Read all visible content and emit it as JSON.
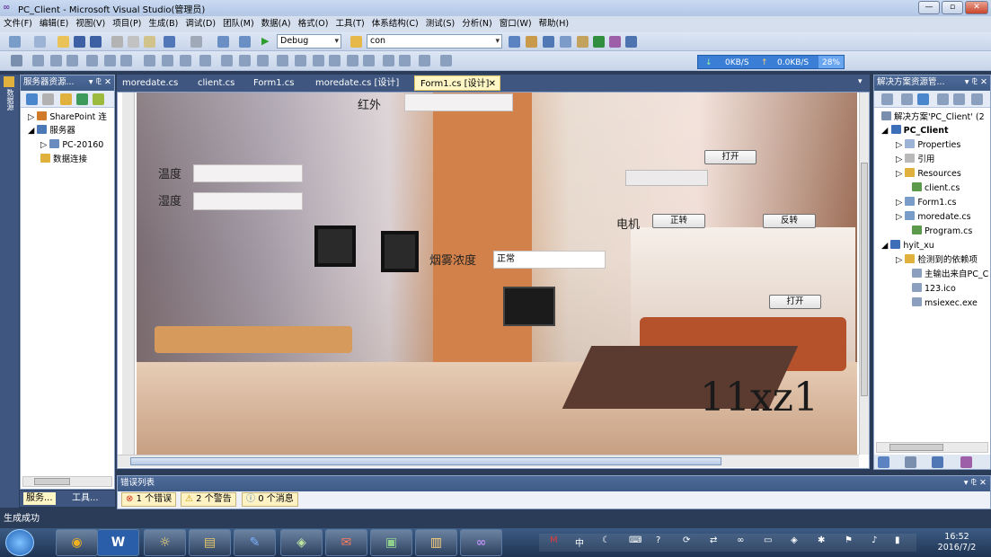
{
  "window": {
    "title": "PC_Client - Microsoft Visual Studio(管理员)",
    "min": "—",
    "max": "▫",
    "close": "✕"
  },
  "menu": [
    "文件(F)",
    "编辑(E)",
    "视图(V)",
    "项目(P)",
    "生成(B)",
    "调试(D)",
    "团队(M)",
    "数据(A)",
    "格式(O)",
    "工具(T)",
    "体系结构(C)",
    "测试(S)",
    "分析(N)",
    "窗口(W)",
    "帮助(H)"
  ],
  "toolbar": {
    "config": "Debug",
    "search": "con"
  },
  "netspeed": {
    "down": "0KB/S",
    "up": "0.0KB/S",
    "pct": "28%"
  },
  "server_explorer": {
    "title": "服务器资源...",
    "pin": "▾ ⅊ ✕",
    "items": [
      "SharePoint 连",
      "服务器",
      "PC-20160",
      "数据连接"
    ]
  },
  "left_rail_label": "数据源",
  "tabs": [
    {
      "label": "moredate.cs"
    },
    {
      "label": "client.cs"
    },
    {
      "label": "Form1.cs"
    },
    {
      "label": "moredate.cs [设计]"
    },
    {
      "label": "Form1.cs [设计]",
      "close": "✕"
    }
  ],
  "form": {
    "infrared_label": "红外",
    "temp_label": "温度",
    "humidity_label": "湿度",
    "smoke_label": "烟雾浓度",
    "smoke_value": "正常",
    "motor_label": "电机",
    "open1": "打开",
    "forward": "正转",
    "reverse": "反转",
    "open2": "打开",
    "watermark": "11xz1"
  },
  "solution_explorer": {
    "title": "解决方案资源管...",
    "pin": "▾ ⅊ ✕",
    "items": [
      "解决方案'PC_Client' (2",
      "PC_Client",
      "Properties",
      "引用",
      "Resources",
      "client.cs",
      "Form1.cs",
      "moredate.cs",
      "Program.cs",
      "hyit_xu",
      "检测到的依赖项",
      "主输出来自PC_C",
      "123.ico",
      "msiexec.exe"
    ]
  },
  "bottom_tabs": {
    "left1": "服务...",
    "left2": "工具..."
  },
  "error_list": {
    "title": "错误列表",
    "errors": "1 个错误",
    "warnings": "2 个警告",
    "messages": "0 个消息",
    "pin": "▾ ⅊ ✕"
  },
  "status": "生成成功",
  "clock": {
    "time": "16:52",
    "date": "2016/7/2"
  },
  "colors": {
    "accent": "#3a7fd5",
    "chrome": "#2b3c59",
    "active_tab": "#fff6c5"
  }
}
